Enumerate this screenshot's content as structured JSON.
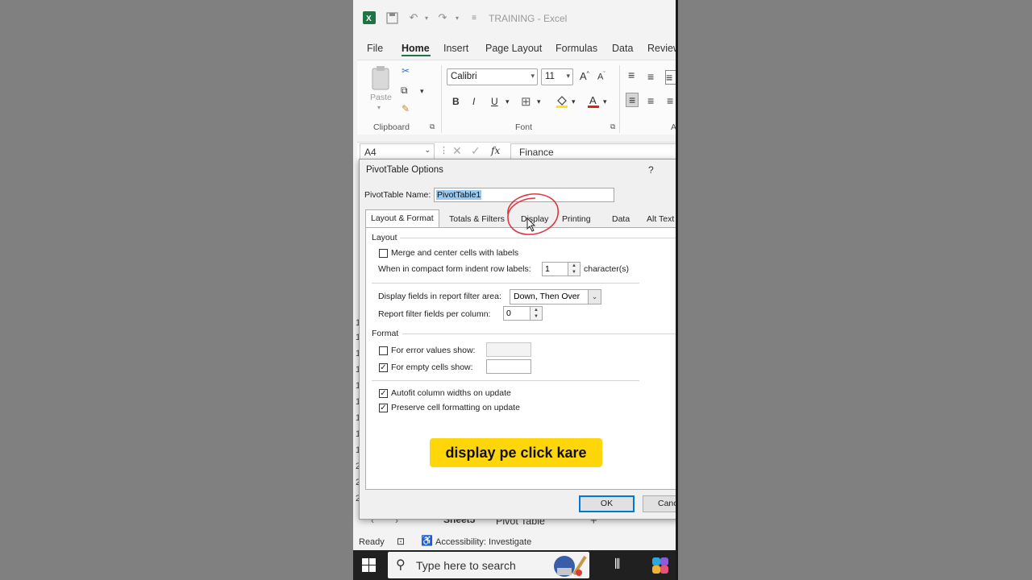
{
  "window": {
    "title": "TRAINING  -  Excel"
  },
  "menu": {
    "tabs": [
      "File",
      "Home",
      "Insert",
      "Page Layout",
      "Formulas",
      "Data",
      "Review"
    ],
    "active": "Home"
  },
  "ribbon": {
    "paste_label": "Paste",
    "clipboard_group": "Clipboard",
    "font_group": "Font",
    "font_name": "Calibri",
    "font_size": "11",
    "grow_font": "A",
    "shrink_font": "A",
    "bold": "B",
    "italic": "I",
    "underline": "U",
    "font_color_glyph": "A",
    "alignment_group": "A"
  },
  "formula_bar": {
    "cell_ref": "A4",
    "fx": "fx",
    "value": "Finance"
  },
  "row_numbers": [
    "1",
    "1",
    "1",
    "1",
    "1",
    "1",
    "1",
    "1",
    "1",
    "2",
    "2",
    "2"
  ],
  "dialog": {
    "title": "PivotTable Options",
    "help": "?",
    "name_label": "PivotTable Name:",
    "name_value": "PivotTable1",
    "tabs": [
      "Layout & Format",
      "Totals & Filters",
      "Display",
      "Printing",
      "Data",
      "Alt Text"
    ],
    "active_tab": "Layout & Format",
    "layout_section": "Layout",
    "merge_label": "Merge and center cells with labels",
    "merge_checked": false,
    "indent_label": "When in compact form indent row labels:",
    "indent_value": "1",
    "indent_unit": "character(s)",
    "filter_area_label": "Display fields in report filter area:",
    "filter_area_value": "Down, Then Over",
    "filter_per_col_label": "Report filter fields per column:",
    "filter_per_col_value": "0",
    "format_section": "Format",
    "error_label": "For error values show:",
    "error_checked": false,
    "empty_label": "For empty cells show:",
    "empty_checked": true,
    "autofit_label": "Autofit column widths on update",
    "autofit_checked": true,
    "preserve_label": "Preserve cell formatting on update",
    "preserve_checked": true,
    "ok": "OK",
    "cancel": "Canc"
  },
  "caption": "display pe click kare",
  "sheets": {
    "tabs": [
      "Sheet5",
      "Pivot Table"
    ],
    "add": "+"
  },
  "status": {
    "ready": "Ready",
    "accessibility": "Accessibility: Investigate"
  },
  "taskbar": {
    "search_placeholder": "Type here to search"
  },
  "colors": {
    "excel_green": "#217346",
    "caption_bg": "#ffd60a",
    "annotation_red": "#e0383e",
    "ok_border": "#0078d7"
  }
}
